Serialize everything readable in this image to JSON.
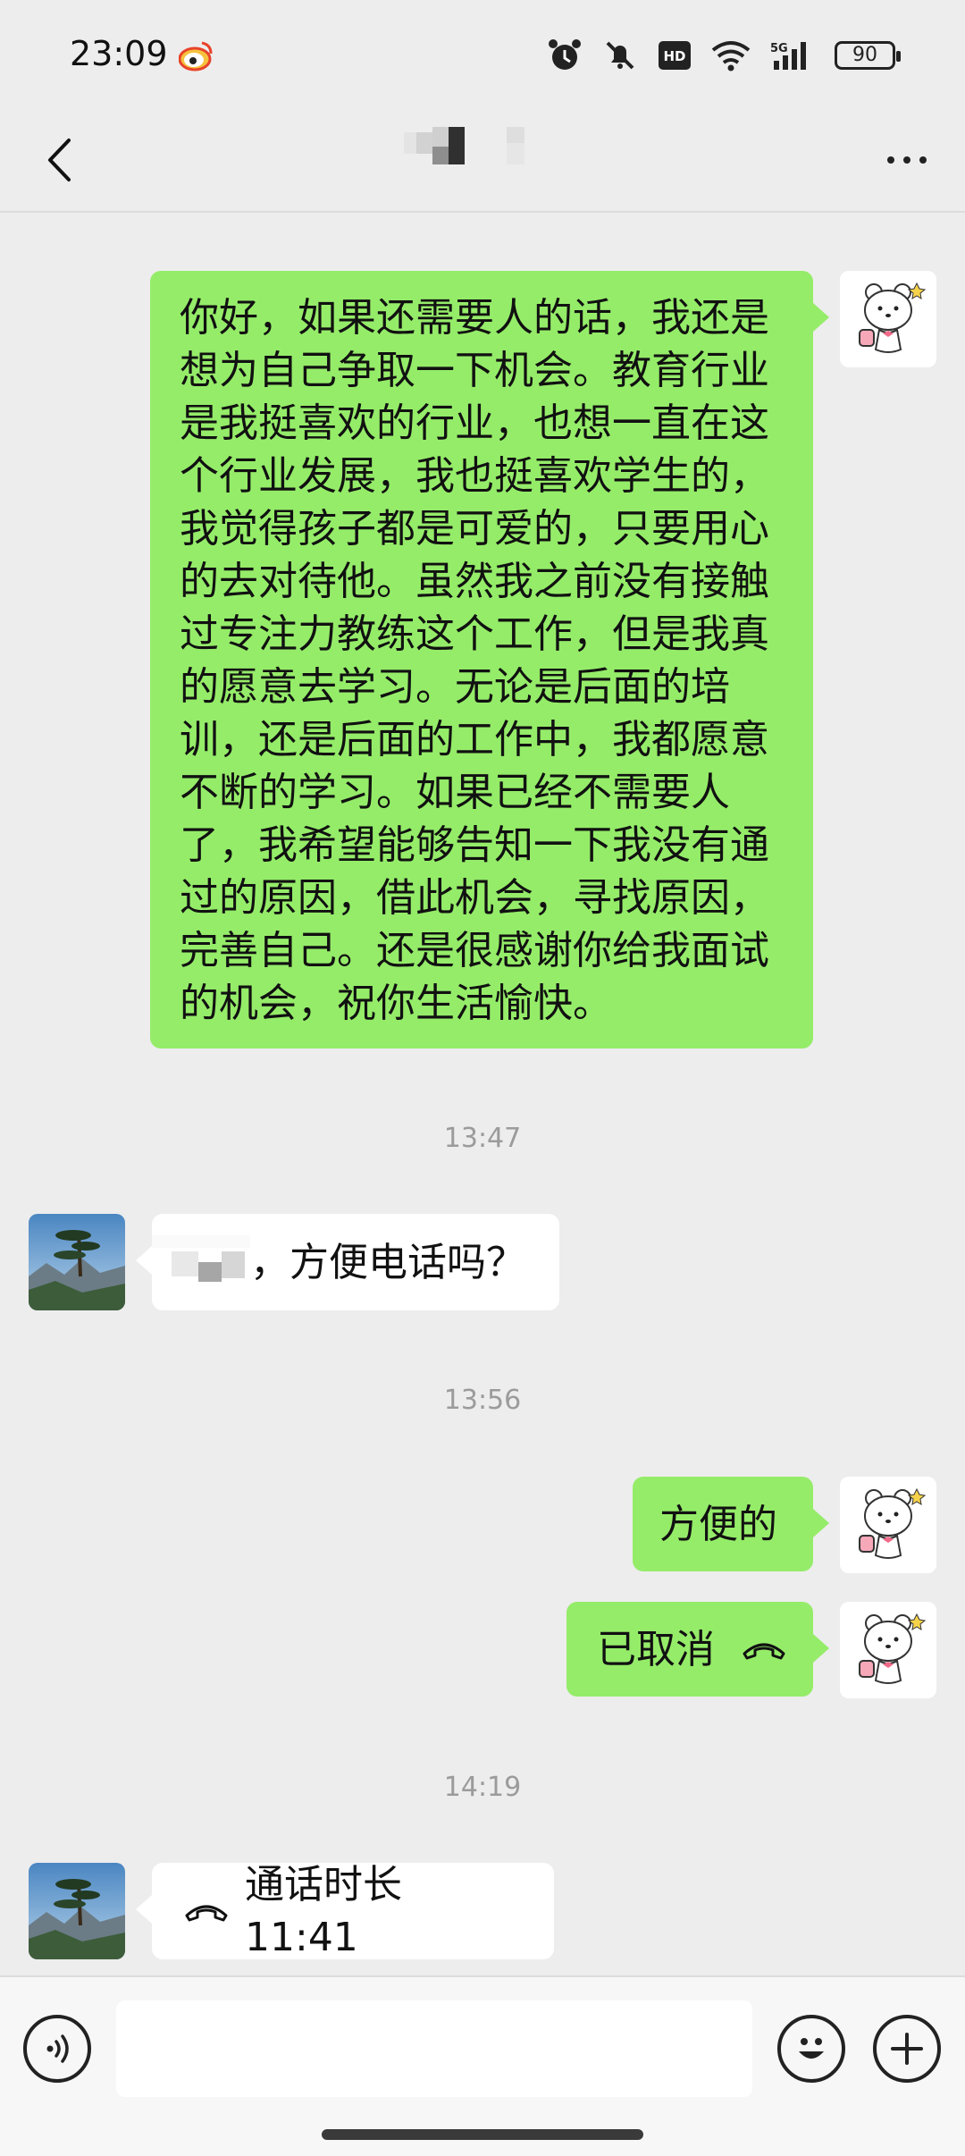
{
  "status_bar": {
    "time": "23:09",
    "battery": "90",
    "icons": [
      "weibo-icon",
      "alarm-icon",
      "mute-icon",
      "hd-icon",
      "wifi-icon",
      "signal-5g-icon",
      "battery-icon"
    ]
  },
  "header": {
    "contact_name": "",
    "back_icon": "chevron-left-icon",
    "more_icon": "more-horizontal-icon"
  },
  "messages": {
    "msg1": {
      "sender": "me",
      "lines": [
        "你好，如果还需要人的话，我还是",
        "想为自己争取一下机会。教育行业",
        "是我挺喜欢的行业，也想一直在这",
        "个行业发展，我也挺喜欢学生的，",
        "我觉得孩子都是可爱的，只要用心",
        "的去对待他。虽然我之前没有接触",
        "过专注力教练这个工作，但是我真",
        "的愿意去学习。无论是后面的培",
        "训，还是后面的工作中，我都愿意",
        "不断的学习。如果已经不需要人",
        "了，我希望能够告知一下我没有通",
        "过的原因，借此机会，寻找原因，",
        "完善自己。还是很感谢你给我面试",
        "的机会，祝你生活愉快。"
      ]
    },
    "ts1": "13:47",
    "msg2": {
      "sender": "them",
      "text": "，方便电话吗？"
    },
    "ts2": "13:56",
    "msg3": {
      "sender": "me",
      "text": "方便的"
    },
    "msg4": {
      "sender": "me",
      "text": "已取消",
      "icon": "phone-hangup-icon"
    },
    "ts3": "14:19",
    "msg5": {
      "sender": "them",
      "text": "通话时长 11:41",
      "icon": "phone-hangup-icon"
    }
  },
  "input_bar": {
    "placeholder": "",
    "voice_icon": "voice-icon",
    "emoji_icon": "emoji-icon",
    "plus_icon": "plus-icon"
  },
  "colors": {
    "background": "#ededed",
    "my_bubble": "#95ec69",
    "their_bubble": "#ffffff",
    "timestamp": "#9b9b9b"
  }
}
